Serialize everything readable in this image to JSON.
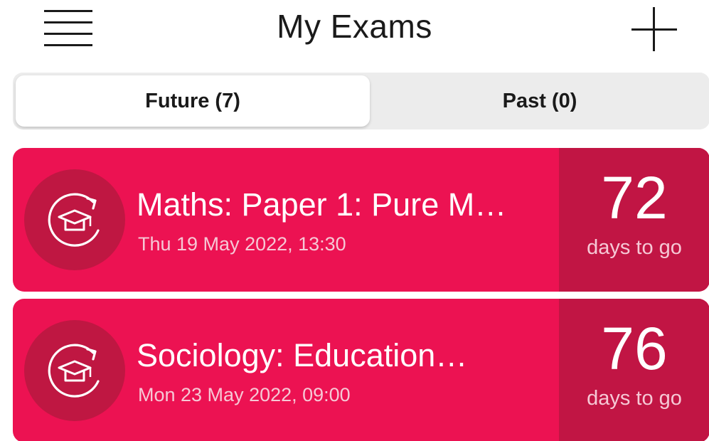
{
  "header": {
    "title": "My Exams",
    "menu_icon": "hamburger-menu-icon",
    "add_icon": "plus-icon"
  },
  "tabs": [
    {
      "label": "Future  (7)",
      "selected": true
    },
    {
      "label": "Past  (0)",
      "selected": false
    }
  ],
  "exams": [
    {
      "title": "Maths: Paper 1: Pure M…",
      "date": "Thu 19 May 2022, 13:30",
      "days": "72",
      "days_label": "days to go",
      "icon": "graduation-cap-refresh-icon"
    },
    {
      "title": "Sociology: Education…",
      "date": "Mon 23 May 2022, 09:00",
      "days": "76",
      "days_label": "days to go",
      "icon": "graduation-cap-refresh-icon"
    }
  ],
  "colors": {
    "card_background": "#ec1252",
    "countdown_background": "#c11544",
    "icon_circle": "#bf1742",
    "segmented_background": "#ececec"
  }
}
